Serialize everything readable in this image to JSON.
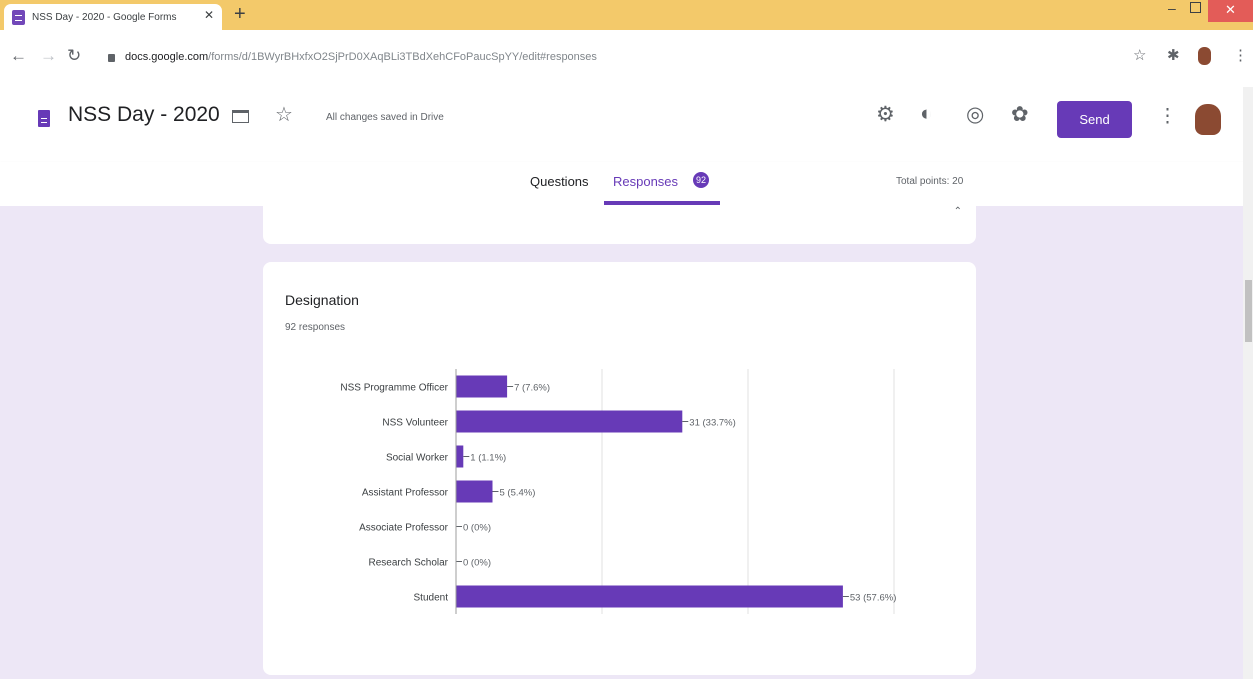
{
  "browser": {
    "tab_title": "NSS Day - 2020 - Google Forms",
    "tab_close": "✕",
    "new_tab": "+",
    "url_host": "docs.google.com",
    "url_path": "/forms/d/1BWyrBHxfxO2SjPrD0XAqBLi3TBdXehCFoPaucSpYY/edit#responses"
  },
  "form": {
    "title": "NSS Day - 2020",
    "saved_status": "All changes saved in Drive",
    "send_label": "Send",
    "tabs": {
      "questions": "Questions",
      "responses": "Responses",
      "responses_count": "92"
    },
    "total_points": "Total points: 20"
  },
  "question": {
    "title": "Designation",
    "response_count": "92 responses"
  },
  "chart_data": {
    "type": "bar",
    "orientation": "horizontal",
    "categories": [
      "NSS Programme Officer",
      "NSS Volunteer",
      "Social Worker",
      "Assistant Professor",
      "Associate Professor",
      "Research Scholar",
      "Student"
    ],
    "values": [
      7,
      31,
      1,
      5,
      0,
      0,
      53
    ],
    "data_labels": [
      "7 (7.6%)",
      "31 (33.7%)",
      "1 (1.1%)",
      "5 (5.4%)",
      "0 (0%)",
      "0 (0%)",
      "53 (57.6%)"
    ],
    "xticks": [
      0,
      20,
      40,
      60
    ],
    "xlim": [
      0,
      60
    ],
    "grid": true,
    "bar_color": "#673ab7"
  },
  "colors": {
    "accent": "#673ab7",
    "background": "#ede7f6"
  }
}
